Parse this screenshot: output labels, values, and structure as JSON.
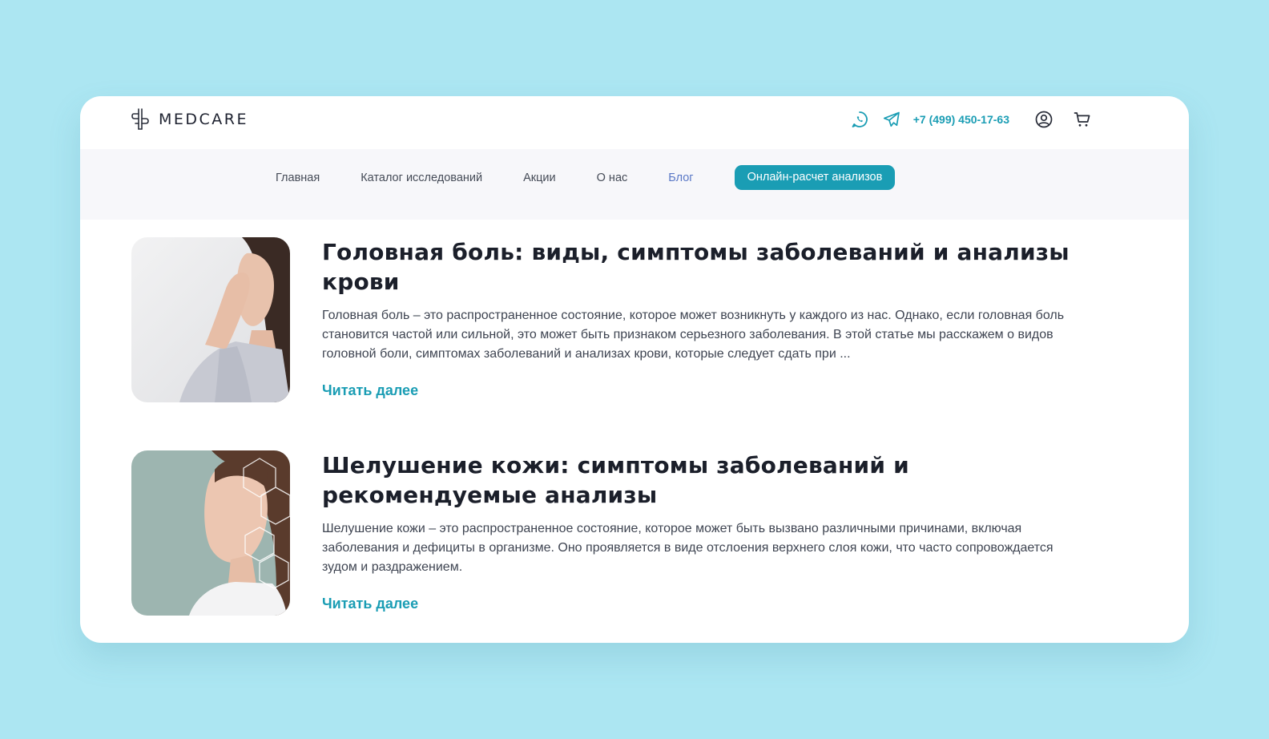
{
  "header": {
    "logo_text": "MEDCARE",
    "phone": "+7 (499) 450-17-63",
    "icons": [
      "whatsapp-icon",
      "telegram-icon",
      "user-icon",
      "cart-icon"
    ]
  },
  "nav": {
    "items": [
      {
        "label": "Главная",
        "active": false
      },
      {
        "label": "Каталог исследований",
        "active": false
      },
      {
        "label": "Акции",
        "active": false
      },
      {
        "label": "О нас",
        "active": false
      },
      {
        "label": "Блог",
        "active": true
      }
    ],
    "cta_label": "Онлайн-расчет анализов"
  },
  "articles": [
    {
      "title": "Головная боль: виды, симптомы заболеваний и анализы крови",
      "excerpt": "Головная боль – это распространенное состояние, которое может возникнуть у каждого из нас. Однако, если головная боль становится частой или сильной, это может быть признаком серьезного заболевания. В этой статье мы расскажем о видов головной боли, симптомах заболеваний и анализах крови, которые следует сдать при ...",
      "read_more": "Читать далее"
    },
    {
      "title": "Шелушение кожи: симптомы заболеваний и рекомендуемые анализы",
      "excerpt": "Шелушение кожи – это распространенное состояние, которое может быть вызвано различными причинами, включая заболевания и дефициты в организме. Оно проявляется в виде отслоения верхнего слоя кожи, что часто сопровождается зудом и раздражением.",
      "read_more": "Читать далее"
    }
  ],
  "colors": {
    "background": "#ace6f2",
    "accent": "#1a9db4",
    "active_nav": "#5a78c6",
    "navbar_bg": "#f7f7fa"
  }
}
